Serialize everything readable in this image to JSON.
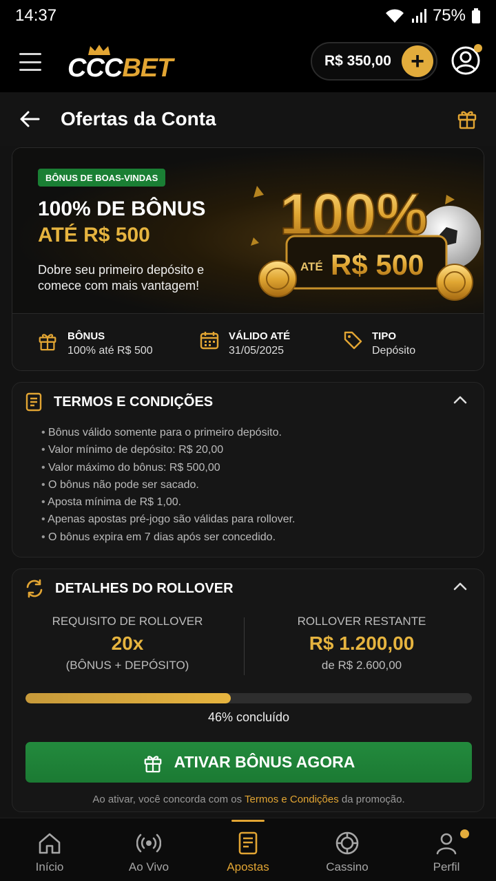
{
  "status_bar": {
    "time": "14:37",
    "battery": "75%"
  },
  "header": {
    "logo_primary": "CCC",
    "logo_secondary": "BET",
    "balance": "R$ 350,00",
    "add_symbol": "+"
  },
  "page": {
    "title": "Ofertas da Conta"
  },
  "promo": {
    "badge": "BÔNUS DE BOAS-VINDAS",
    "title_line1": "100% DE BÔNUS",
    "title_line2": "ATÉ R$ 500",
    "description": "Dobre seu primeiro depósito e comece com mais vantagem!",
    "art_percent": "100%",
    "art_prefix": "ATÉ",
    "art_amount": "R$ 500",
    "info": [
      {
        "label": "BÔNUS",
        "value": "100% até R$ 500",
        "icon": "gift-icon"
      },
      {
        "label": "VÁLIDO ATÉ",
        "value": "31/05/2025",
        "icon": "calendar-icon"
      },
      {
        "label": "TIPO",
        "value": "Depósito",
        "icon": "tag-icon"
      }
    ]
  },
  "terms": {
    "title": "TERMOS E CONDIÇÕES",
    "items": [
      "Bônus válido somente para o primeiro depósito.",
      "Valor mínimo de depósito: R$ 20,00",
      "Valor máximo do bônus: R$ 500,00",
      "O bônus não pode ser sacado.",
      "Aposta mínima de R$ 1,00.",
      "Apenas apostas pré-jogo são válidas para rollover.",
      "O bônus expira em 7 dias após ser concedido."
    ]
  },
  "rollover": {
    "title": "DETALHES DO ROLLOVER",
    "requirement_label": "REQUISITO DE ROLLOVER",
    "requirement_value": "20x",
    "requirement_sub": "(BÔNUS + DEPÓSITO)",
    "remaining_label": "ROLLOVER RESTANTE",
    "remaining_value": "R$ 1.200,00",
    "remaining_sub": "de R$ 2.600,00",
    "progress_percent": 46,
    "progress_text": "46% concluído",
    "cta_label": "ATIVAR BÔNUS AGORA",
    "note_prefix": "Ao ativar, você concorda com os",
    "note_link": "Termos e Condições",
    "note_suffix": "da promoção."
  },
  "bottom_nav": [
    {
      "label": "Início",
      "icon": "home-icon"
    },
    {
      "label": "Ao Vivo",
      "icon": "live-icon"
    },
    {
      "label": "Apostas",
      "icon": "betslip-icon",
      "active": true
    },
    {
      "label": "Cassino",
      "icon": "casino-chip-icon"
    },
    {
      "label": "Perfil",
      "icon": "user-icon"
    }
  ],
  "colors": {
    "accent_gold": "#e2a533",
    "cta_green": "#1b7a33",
    "badge_green": "#1a7f34",
    "background": "#131313"
  }
}
